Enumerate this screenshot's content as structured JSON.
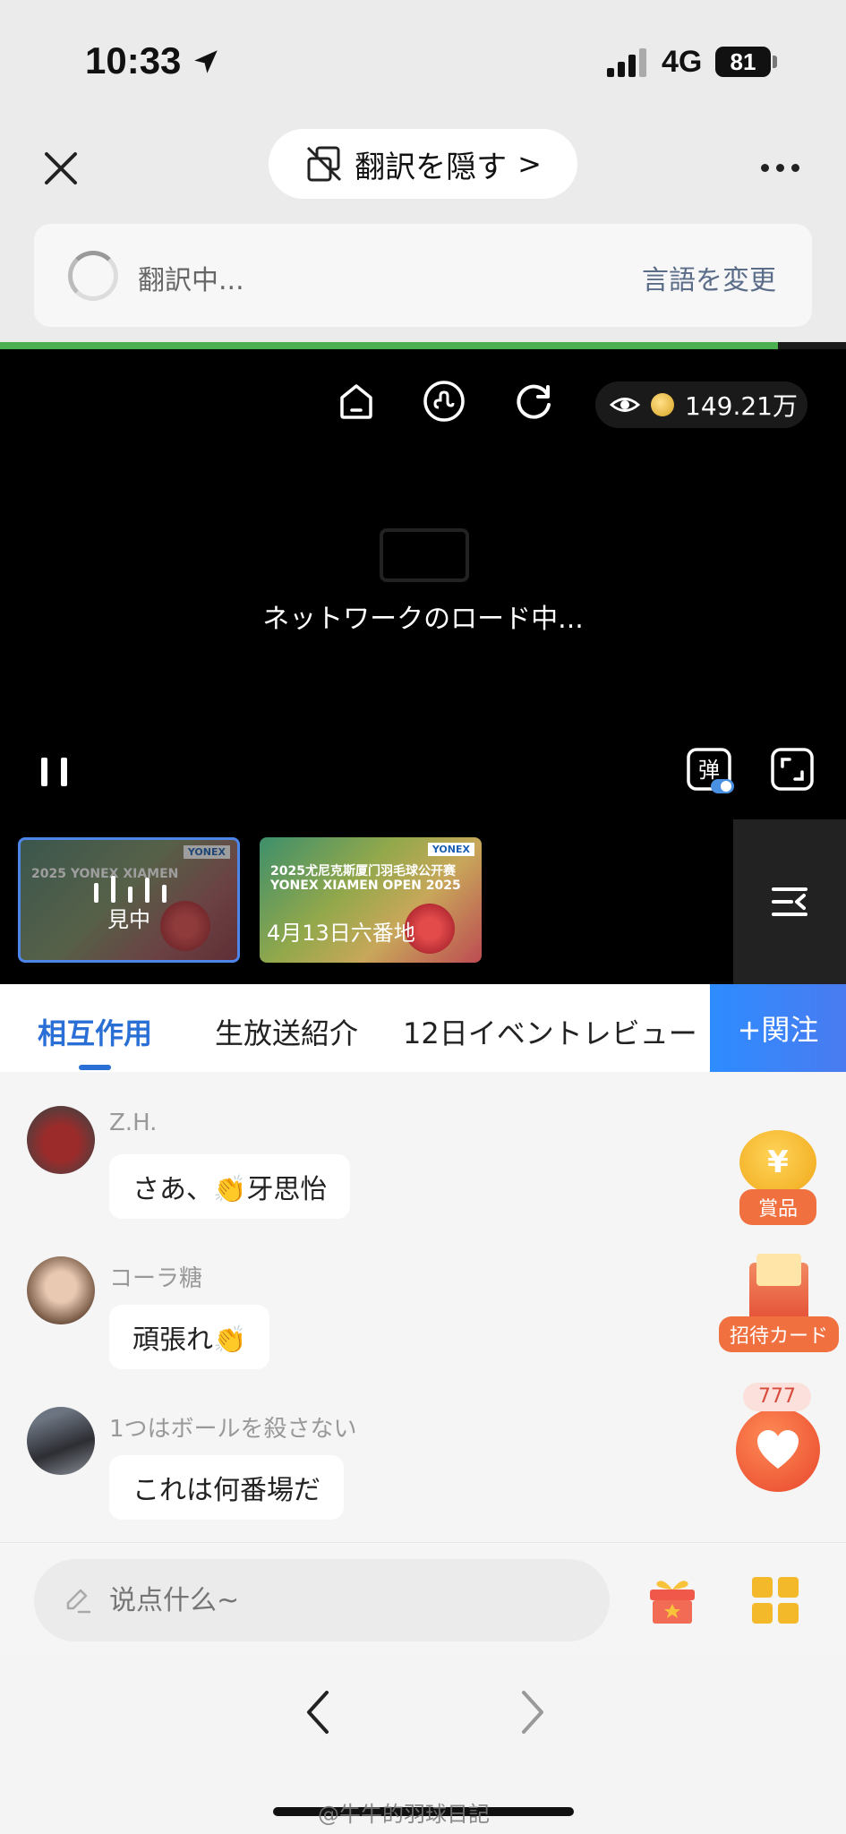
{
  "status": {
    "time": "10:33",
    "network": "4G",
    "battery": "81"
  },
  "topbar": {
    "hide_translation": "翻訳を隠す",
    "chevron": ">",
    "translating": "翻訳中...",
    "change_language": "言語を変更"
  },
  "page_load_progress": 0.92,
  "video": {
    "viewers": "149.21万",
    "loading_text": "ネットワークのロード中...",
    "danmu_label": "弹"
  },
  "playlist": [
    {
      "label": "見中",
      "title": "2025 YONEX XIAMEN",
      "brand": "YONEX",
      "active": true
    },
    {
      "label": "4月13日六番地",
      "title": "2025尤尼克斯厦门羽毛球公开赛 YONEX XIAMEN OPEN 2025",
      "brand": "YONEX",
      "active": false
    }
  ],
  "tabs": [
    {
      "label": "相互作用",
      "active": true
    },
    {
      "label": "生放送紹介",
      "active": false
    },
    {
      "label": "12日イベントレビュー",
      "active": false
    }
  ],
  "follow_label": "+関注",
  "messages": [
    {
      "user": "Z.H.",
      "text": "さあ、👏牙思怡"
    },
    {
      "user": "コーラ糖",
      "text": "頑張れ👏"
    },
    {
      "user": "1つはボールを殺さない",
      "text": "これは何番場だ"
    }
  ],
  "side": {
    "prize_symbol": "¥",
    "prize_label": "賞品",
    "invite_label": "招待カード",
    "like_count": "777"
  },
  "input": {
    "placeholder": "说点什么~"
  },
  "watermark": "@牛牛的羽球日記",
  "colors": {
    "accent": "#2a6fd6",
    "progress": "#4caf50",
    "follow": "#2d8cff",
    "side_orange": "#f07040"
  }
}
